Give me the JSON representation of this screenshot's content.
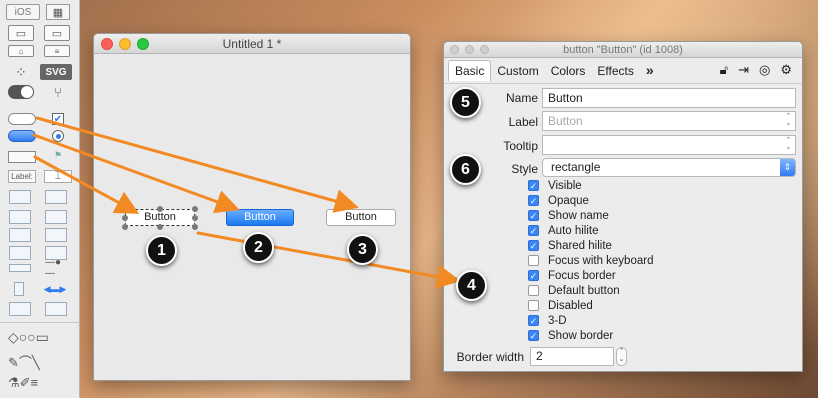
{
  "tools_palette": {
    "ios_label": "iOS",
    "svg_label": "SVG",
    "label_tool": "Label:"
  },
  "stack_window": {
    "title": "Untitled 1 *",
    "buttons": [
      {
        "label": "Button"
      },
      {
        "label": "Button"
      },
      {
        "label": "Button"
      }
    ]
  },
  "inspector": {
    "title": "button \"Button\" (id 1008)",
    "tabs": [
      "Basic",
      "Custom",
      "Colors",
      "Effects"
    ],
    "more_tabs": "»",
    "fields": {
      "name_label": "Name",
      "name_value": "Button",
      "label_label": "Label",
      "label_placeholder": "Button",
      "tooltip_label": "Tooltip",
      "tooltip_value": "",
      "style_label": "Style",
      "style_value": "rectangle"
    },
    "options": [
      {
        "label": "Visible",
        "checked": true
      },
      {
        "label": "Opaque",
        "checked": true
      },
      {
        "label": "Show name",
        "checked": true
      },
      {
        "label": "Auto hilite",
        "checked": true
      },
      {
        "label": "Shared hilite",
        "checked": true
      },
      {
        "label": "Focus with keyboard",
        "checked": false
      },
      {
        "label": "Focus border",
        "checked": true
      },
      {
        "label": "Default button",
        "checked": false
      },
      {
        "label": "Disabled",
        "checked": false
      },
      {
        "label": "3-D",
        "checked": true
      },
      {
        "label": "Show border",
        "checked": true
      }
    ],
    "border_width_label": "Border width",
    "border_width_value": "2"
  },
  "callouts": [
    "1",
    "2",
    "3",
    "4",
    "5",
    "6"
  ],
  "colors": {
    "accent_blue": "#2f7bf0",
    "arrow_orange": "#f28a24"
  }
}
